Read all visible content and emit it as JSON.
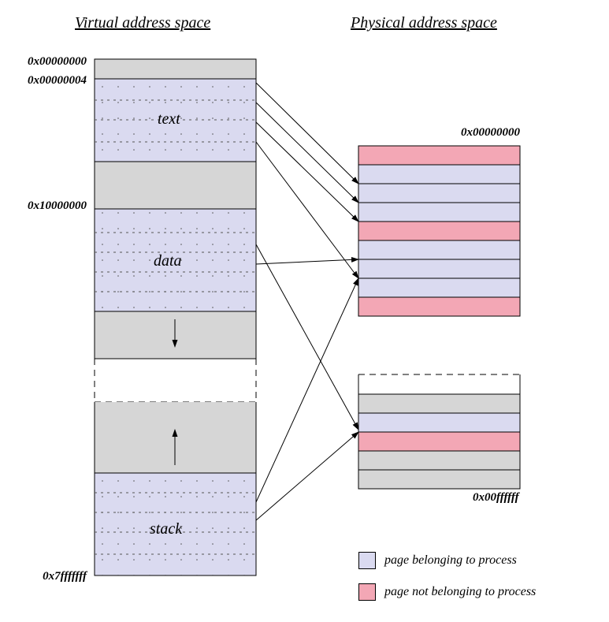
{
  "titles": {
    "left": "Virtual address space",
    "right": "Physical address space"
  },
  "virtual": {
    "addresses": {
      "top1": "0x00000000",
      "top2": "0x00000004",
      "mid": "0x10000000",
      "bottom": "0x7fffffff"
    },
    "segments": {
      "text": "text",
      "data": "data",
      "stack": "stack"
    }
  },
  "physical": {
    "addresses": {
      "top": "0x00000000",
      "bottom": "0x00ffffff"
    },
    "frames_top": [
      {
        "color": "pink"
      },
      {
        "color": "blue"
      },
      {
        "color": "blue"
      },
      {
        "color": "blue"
      },
      {
        "color": "pink"
      },
      {
        "color": "blue"
      },
      {
        "color": "blue"
      },
      {
        "color": "blue"
      },
      {
        "color": "pink"
      }
    ],
    "frames_bottom": [
      {
        "color": "gray"
      },
      {
        "color": "blue"
      },
      {
        "color": "pink"
      },
      {
        "color": "gray"
      },
      {
        "color": "gray"
      }
    ]
  },
  "legend": {
    "process": "page belonging to process",
    "notprocess": "page not belonging to process"
  },
  "colors": {
    "blue": "#DADAF0",
    "pink": "#F3A7B5",
    "gray": "#D6D6D6",
    "stroke": "#000000"
  },
  "mappings": [
    {
      "from": [
        325,
        105
      ],
      "to": [
        455,
        233
      ]
    },
    {
      "from": [
        325,
        130
      ],
      "to": [
        455,
        257
      ]
    },
    {
      "from": [
        325,
        155
      ],
      "to": [
        455,
        281
      ]
    },
    {
      "from": [
        325,
        180
      ],
      "to": [
        455,
        353
      ]
    },
    {
      "from": [
        325,
        310
      ],
      "to": [
        455,
        545
      ]
    },
    {
      "from": [
        325,
        335
      ],
      "to": [
        455,
        329
      ]
    },
    {
      "from": [
        325,
        637
      ],
      "to": [
        455,
        353
      ]
    },
    {
      "from": [
        325,
        660
      ],
      "to": [
        455,
        548
      ]
    }
  ]
}
